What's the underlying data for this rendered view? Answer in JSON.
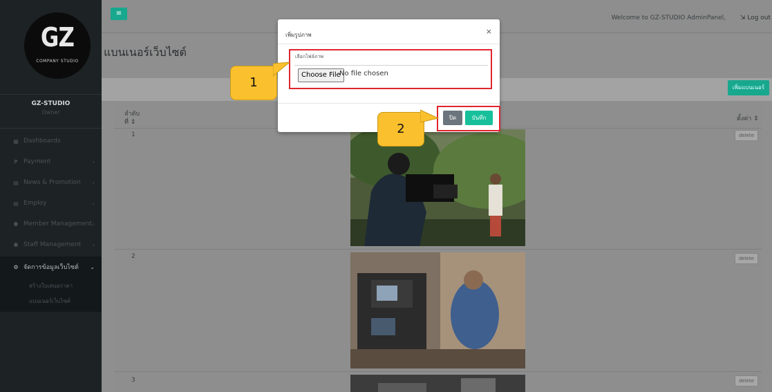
{
  "colors": {
    "sidebar": "#1d2225",
    "accent": "#17a88e",
    "save": "#17c09a",
    "highlight": "#e0242e",
    "callout": "#fbc02d"
  },
  "sidebar": {
    "logo_text": "GZ",
    "logo_subtext": "COMPANY STUDIO",
    "profile_name": "GZ-STUDIO",
    "profile_role": "Owner",
    "items": [
      {
        "icon": "grid-icon",
        "glyph": "▦",
        "label": "Dashboards",
        "chevron": ""
      },
      {
        "icon": "payment-icon",
        "glyph": "₱",
        "label": "Payment",
        "chevron": "‹"
      },
      {
        "icon": "news-icon",
        "glyph": "▤",
        "label": "News & Promotion",
        "chevron": "‹"
      },
      {
        "icon": "employ-icon",
        "glyph": "▤",
        "label": "Employ",
        "chevron": "‹"
      },
      {
        "icon": "members-icon",
        "glyph": "⚉",
        "label": "Member Management",
        "chevron": "‹"
      },
      {
        "icon": "staff-icon",
        "glyph": "⚉",
        "label": "Staff Management",
        "chevron": "‹"
      },
      {
        "icon": "cogs-icon",
        "glyph": "⚙",
        "label": "จัดการข้อมูลเว็บไซต์",
        "chevron": "⌄"
      }
    ],
    "submenu": [
      {
        "label": "สร้างใบเสนอราคา"
      },
      {
        "label": "แบนเนอร์เว็บไซต์"
      }
    ]
  },
  "topbar": {
    "menu_glyph": "≡",
    "welcome": "Welcome to GZ-STUDIO AdminPanel,",
    "logout": "⇲ Log out"
  },
  "page": {
    "title": "แบนเนอร์เว็บไซต์",
    "add_button": "เพิ่มแบนเนอร์"
  },
  "table": {
    "headers": {
      "order_line1": "ลำดับ",
      "order_line2": "ที่ ⇕",
      "settings": "ตั้งค่า ⇕"
    },
    "rows": [
      {
        "num": "1",
        "action": "delete"
      },
      {
        "num": "2",
        "action": "delete"
      },
      {
        "num": "3",
        "action": "delete"
      }
    ]
  },
  "modal": {
    "title": "เพิ่มรูปภาพ",
    "close_glyph": "×",
    "field_label": "เลือกไฟล์ภาพ",
    "file_button": "Choose File",
    "file_status": "No file chosen",
    "btn_close": "ปิด",
    "btn_save": "บันทึก"
  },
  "callouts": {
    "one": "1",
    "two": "2"
  }
}
